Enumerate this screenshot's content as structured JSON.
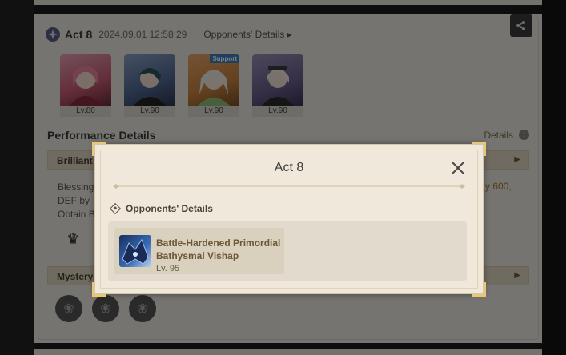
{
  "background": {
    "act": {
      "title": "Act 8",
      "date": "2024.09.01 12:58:29",
      "opponents_link": "Opponents' Details ▸"
    },
    "characters": [
      {
        "level": "Lv.80",
        "support": ""
      },
      {
        "level": "Lv.90",
        "support": ""
      },
      {
        "level": "Lv.90",
        "support": "Support"
      },
      {
        "level": "Lv.90",
        "support": ""
      }
    ],
    "performance_title": "Performance Details",
    "details_link": "Details",
    "brilliant_label": "Brilliant",
    "blessing_lines": [
      "Blessing",
      "DEF by",
      "Obtain B"
    ],
    "blessing_right": "y 600,",
    "mystery_label": "Mystery"
  },
  "modal": {
    "title": "Act 8",
    "section_label": "Opponents' Details",
    "opponent": {
      "name_line1": "Battle-Hardened Primordial",
      "name_line2": "Bathysmal Vishap",
      "level": "Lv. 95"
    }
  },
  "colors": {
    "modal_bg": "#efe8db",
    "corner_gold": "#e8c875",
    "accent_brown": "#6b5837"
  }
}
